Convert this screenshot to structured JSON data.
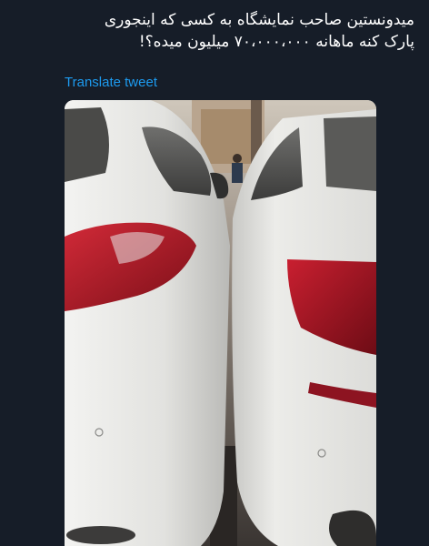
{
  "tweet": {
    "text_line1": "میدونستین صاحب نمایشگاه به کسی که اینجوری",
    "text_line2": "پارک کنه ماهانه ۷۰،۰۰۰،۰۰۰ میلیون میده؟!",
    "translate_label": "Translate tweet"
  },
  "media": {
    "alt": "Two white cars parked tightly side by side in a garage",
    "colors": {
      "background": "#161d28",
      "link": "#1d9bf0",
      "car_body": "#e4e4e2",
      "tail_light": "#b3172a"
    }
  }
}
